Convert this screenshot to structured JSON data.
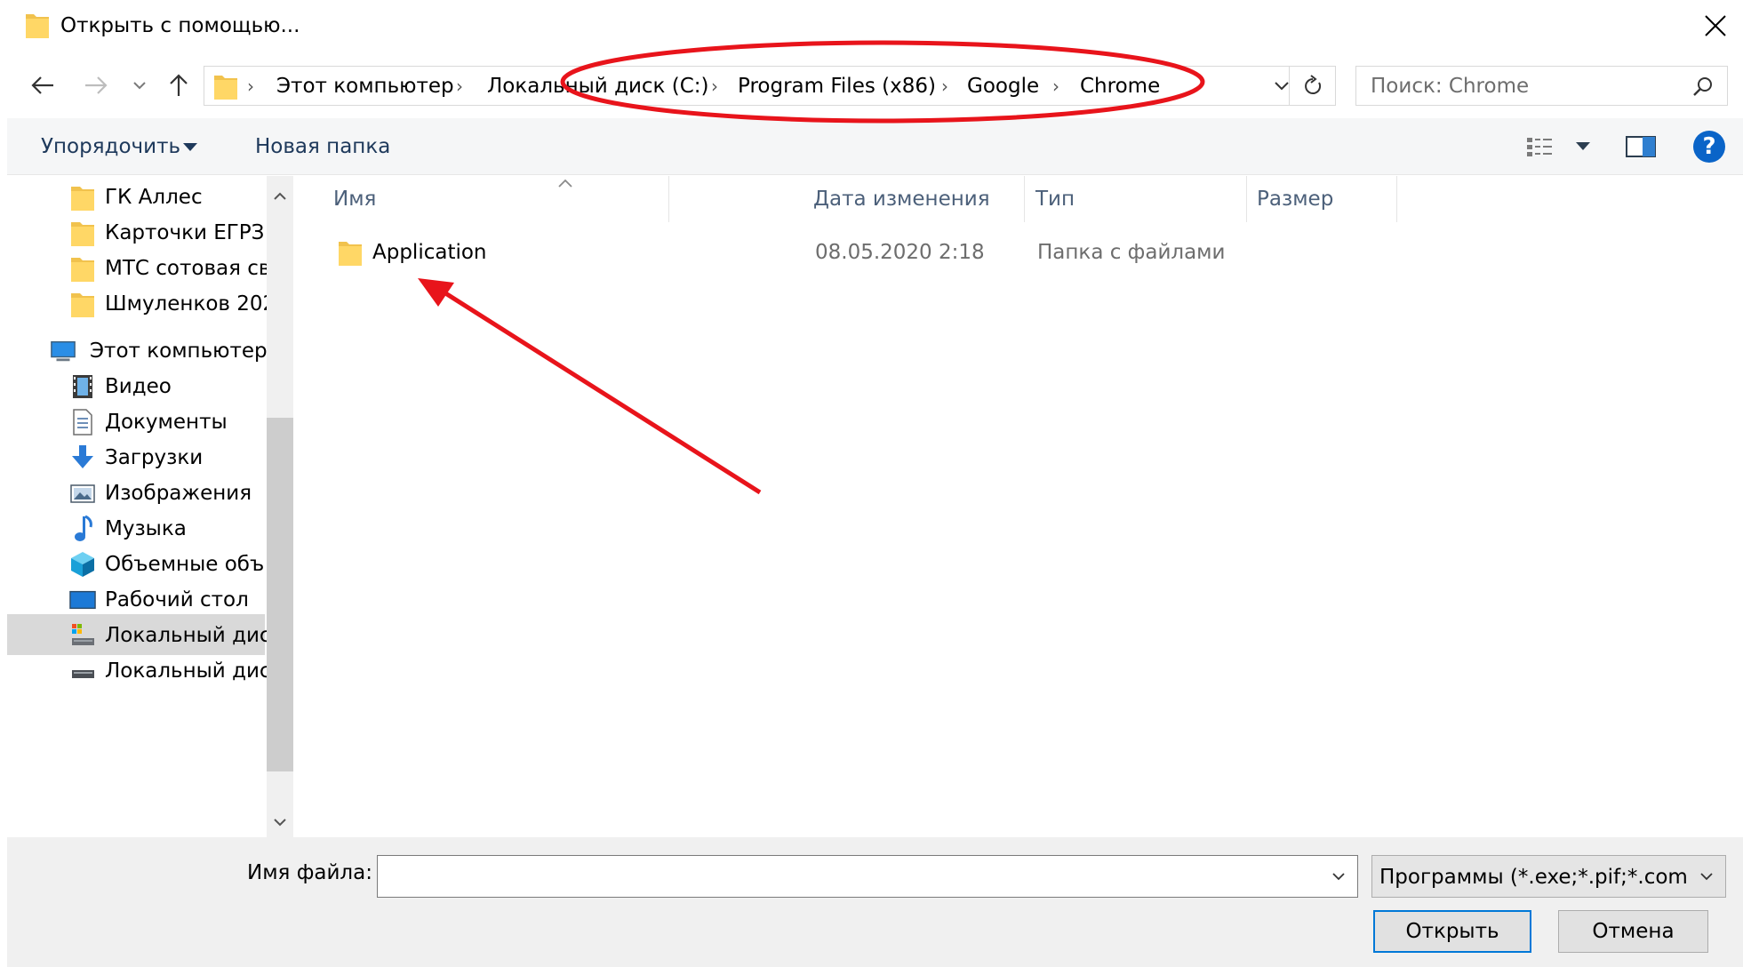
{
  "window": {
    "title": "Открыть с помощью..."
  },
  "address": {
    "crumbs": [
      "Этот компьютер",
      "Локальный диск (C:)",
      "Program Files (x86)",
      "Google",
      "Chrome"
    ],
    "separator": "›"
  },
  "search": {
    "placeholder": "Поиск: Chrome"
  },
  "toolbar": {
    "organize_label": "Упорядочить",
    "new_folder_label": "Новая папка",
    "help_label": "?"
  },
  "sidebar": {
    "items": [
      {
        "label": "ГК Аллес",
        "icon": "folder-icon"
      },
      {
        "label": "Карточки ЕГРЗ",
        "icon": "folder-icon"
      },
      {
        "label": "МТС сотовая св",
        "icon": "folder-icon"
      },
      {
        "label": "Шмуленков 202",
        "icon": "folder-icon"
      },
      {
        "label": "Этот компьютер",
        "icon": "computer-icon"
      },
      {
        "label": "Видео",
        "icon": "video-icon"
      },
      {
        "label": "Документы",
        "icon": "documents-icon"
      },
      {
        "label": "Загрузки",
        "icon": "downloads-icon"
      },
      {
        "label": "Изображения",
        "icon": "pictures-icon"
      },
      {
        "label": "Музыка",
        "icon": "music-icon"
      },
      {
        "label": "Объемные объ",
        "icon": "3d-objects-icon"
      },
      {
        "label": "Рабочий стол",
        "icon": "desktop-icon"
      },
      {
        "label": "Локальный дис",
        "icon": "system-drive-icon",
        "selected": true
      },
      {
        "label": "Локальный дис",
        "icon": "drive-icon"
      }
    ]
  },
  "file_list": {
    "columns": [
      "Имя",
      "Дата изменения",
      "Тип",
      "Размер"
    ],
    "rows": [
      {
        "name": "Application",
        "modified": "08.05.2020 2:18",
        "type": "Папка с файлами",
        "size": ""
      }
    ]
  },
  "bottom": {
    "filename_label": "Имя файла:",
    "filename_value": "",
    "filter_value": "Программы (*.exe;*.pif;*.com;",
    "open_label": "Открыть",
    "cancel_label": "Отмена"
  },
  "colors": {
    "annotation": "#e8141b",
    "accent": "#0078d7",
    "folder": "#ffd766",
    "selection": "#d9d9d9"
  }
}
